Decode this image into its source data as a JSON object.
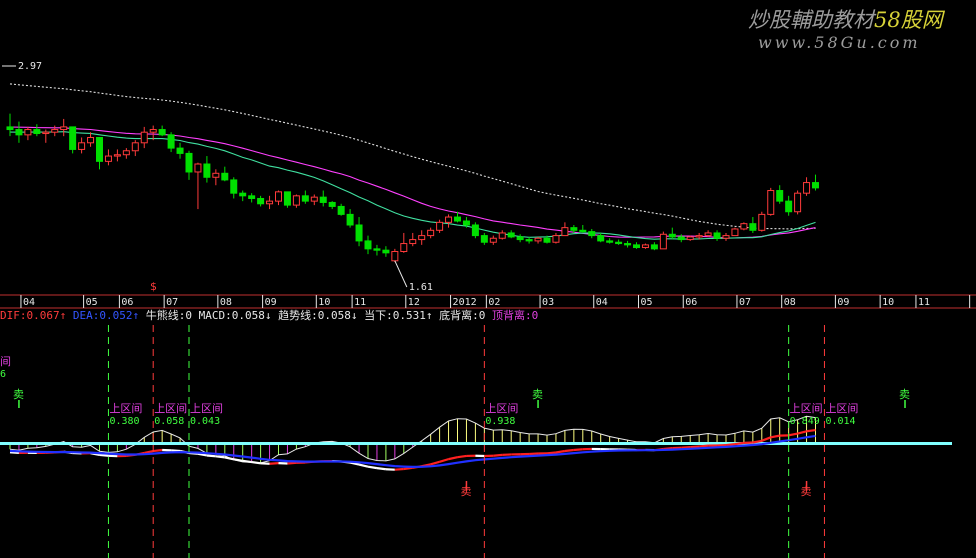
{
  "watermark": {
    "site_name": "炒股輔助教材",
    "site_brand": "58股网",
    "url": "www.58Gu.com"
  },
  "upper": {
    "high_label": "2.97",
    "low_label": "1.61",
    "ylim": [
      1.45,
      3.2
    ],
    "marker_label": "$"
  },
  "month_labels": [
    {
      "text": "04",
      "i": 1
    },
    {
      "text": "05",
      "i": 8
    },
    {
      "text": "06",
      "i": 12
    },
    {
      "text": "07",
      "i": 17
    },
    {
      "text": "08",
      "i": 23
    },
    {
      "text": "09",
      "i": 28
    },
    {
      "text": "10",
      "i": 34
    },
    {
      "text": "11",
      "i": 38
    },
    {
      "text": "12",
      "i": 44
    },
    {
      "text": "2012",
      "i": 49
    },
    {
      "text": "02",
      "i": 53
    },
    {
      "text": "03",
      "i": 59
    },
    {
      "text": "04",
      "i": 65
    },
    {
      "text": "05",
      "i": 70
    },
    {
      "text": "06",
      "i": 75
    },
    {
      "text": "07",
      "i": 81
    },
    {
      "text": "08",
      "i": 86
    },
    {
      "text": "09",
      "i": 92
    },
    {
      "text": "10",
      "i": 97
    },
    {
      "text": "11",
      "i": 101
    },
    {
      "text": "",
      "i": 107
    }
  ],
  "status_line": [
    {
      "text": "DIF:0.067",
      "color": "#ff3b3b"
    },
    {
      "text": "↑",
      "color": "#ff3b3b"
    },
    {
      "text": "DEA:0.052",
      "color": "#3355ff"
    },
    {
      "text": "↑",
      "color": "#3355ff"
    },
    {
      "text": "牛熊线:0",
      "color": "#e8e8e8"
    },
    {
      "text": "MACD:0.058",
      "color": "#e8e8e8"
    },
    {
      "text": "↓",
      "color": "#e8e8e8"
    },
    {
      "text": "趋势线:0.058",
      "color": "#e8e8e8"
    },
    {
      "text": "↓",
      "color": "#e8e8e8"
    },
    {
      "text": "当下:0.531",
      "color": "#e8e8e8"
    },
    {
      "text": "↑",
      "color": "#e8e8e8"
    },
    {
      "text": "底背离:0",
      "color": "#e8e8e8"
    },
    {
      "text": "顶背离:0",
      "color": "#e040e0"
    }
  ],
  "signals": {
    "up_label": "上区间",
    "top_left_label": "间",
    "top_left_value": "6",
    "sell_label": "卖",
    "intervals": [
      {
        "i": 11,
        "value": "0.380"
      },
      {
        "i": 16,
        "value": "0.058"
      },
      {
        "i": 20,
        "value": "0.043"
      },
      {
        "i": 53,
        "value": "0.938"
      },
      {
        "i": 87,
        "value": "0.849"
      },
      {
        "i": 91,
        "value": "0.014"
      }
    ],
    "green_dash_i": [
      11,
      20,
      87
    ],
    "red_dash_i": [
      16,
      53,
      91
    ],
    "sell_marks": [
      {
        "i": 1,
        "side": "top"
      },
      {
        "i": 59,
        "side": "top"
      },
      {
        "i": 51,
        "side": "bottom"
      },
      {
        "i": 100,
        "side": "top"
      },
      {
        "i": 89,
        "side": "bottom"
      }
    ]
  },
  "colors": {
    "up": "#ff3b3b",
    "down": "#00e000",
    "ma_short": "#e0e0e0",
    "ma_mid": "#ff40ff",
    "ma_long": "#40e0a0",
    "dif": "#ffffff",
    "dif_up": "#ff2020",
    "dea": "#2030ff",
    "bar_pos": "#ffff80",
    "bar_neg": "#e040e0",
    "zero_band": "#80ffff",
    "signal_green": "#40ff40",
    "signal_magenta": "#e040e0"
  },
  "chart_data": {
    "type": "line",
    "title": "",
    "xlabel": "",
    "ylabel": "",
    "candles": [
      [
        2.62,
        2.72,
        2.55,
        2.6
      ],
      [
        2.6,
        2.66,
        2.5,
        2.56
      ],
      [
        2.56,
        2.62,
        2.52,
        2.6
      ],
      [
        2.6,
        2.64,
        2.55,
        2.57
      ],
      [
        2.57,
        2.6,
        2.5,
        2.58
      ],
      [
        2.58,
        2.63,
        2.55,
        2.6
      ],
      [
        2.6,
        2.68,
        2.55,
        2.62
      ],
      [
        2.62,
        2.62,
        2.42,
        2.45
      ],
      [
        2.45,
        2.54,
        2.42,
        2.5
      ],
      [
        2.5,
        2.58,
        2.47,
        2.54
      ],
      [
        2.54,
        2.54,
        2.3,
        2.36
      ],
      [
        2.36,
        2.45,
        2.33,
        2.4
      ],
      [
        2.4,
        2.45,
        2.36,
        2.41
      ],
      [
        2.41,
        2.46,
        2.38,
        2.44
      ],
      [
        2.44,
        2.52,
        2.4,
        2.5
      ],
      [
        2.5,
        2.62,
        2.46,
        2.58
      ],
      [
        2.58,
        2.63,
        2.52,
        2.6
      ],
      [
        2.6,
        2.63,
        2.55,
        2.56
      ],
      [
        2.56,
        2.58,
        2.43,
        2.46
      ],
      [
        2.46,
        2.5,
        2.38,
        2.42
      ],
      [
        2.42,
        2.44,
        2.22,
        2.28
      ],
      [
        2.28,
        2.35,
        2.0,
        2.34
      ],
      [
        2.34,
        2.4,
        2.2,
        2.24
      ],
      [
        2.24,
        2.3,
        2.18,
        2.27
      ],
      [
        2.27,
        2.32,
        2.21,
        2.22
      ],
      [
        2.22,
        2.24,
        2.08,
        2.12
      ],
      [
        2.12,
        2.14,
        2.06,
        2.1
      ],
      [
        2.1,
        2.12,
        2.05,
        2.08
      ],
      [
        2.08,
        2.1,
        2.02,
        2.04
      ],
      [
        2.04,
        2.1,
        2.0,
        2.06
      ],
      [
        2.06,
        2.14,
        2.03,
        2.13
      ],
      [
        2.13,
        2.13,
        2.01,
        2.03
      ],
      [
        2.03,
        2.11,
        2.01,
        2.1
      ],
      [
        2.1,
        2.14,
        2.04,
        2.06
      ],
      [
        2.06,
        2.11,
        2.03,
        2.09
      ],
      [
        2.09,
        2.14,
        2.02,
        2.05
      ],
      [
        2.05,
        2.06,
        2.0,
        2.02
      ],
      [
        2.02,
        2.04,
        1.95,
        1.96
      ],
      [
        1.96,
        2.0,
        1.86,
        1.88
      ],
      [
        1.88,
        1.94,
        1.72,
        1.76
      ],
      [
        1.76,
        1.8,
        1.66,
        1.7
      ],
      [
        1.7,
        1.73,
        1.65,
        1.69
      ],
      [
        1.69,
        1.72,
        1.64,
        1.67
      ],
      [
        1.61,
        1.7,
        1.6,
        1.68
      ],
      [
        1.68,
        1.82,
        1.67,
        1.74
      ],
      [
        1.74,
        1.82,
        1.72,
        1.77
      ],
      [
        1.77,
        1.84,
        1.73,
        1.8
      ],
      [
        1.8,
        1.86,
        1.78,
        1.84
      ],
      [
        1.84,
        1.92,
        1.82,
        1.9
      ],
      [
        1.9,
        1.96,
        1.86,
        1.94
      ],
      [
        1.94,
        1.98,
        1.9,
        1.91
      ],
      [
        1.91,
        1.94,
        1.86,
        1.88
      ],
      [
        1.88,
        1.9,
        1.78,
        1.8
      ],
      [
        1.8,
        1.82,
        1.73,
        1.75
      ],
      [
        1.75,
        1.8,
        1.73,
        1.78
      ],
      [
        1.78,
        1.84,
        1.77,
        1.82
      ],
      [
        1.82,
        1.84,
        1.78,
        1.79
      ],
      [
        1.79,
        1.81,
        1.75,
        1.77
      ],
      [
        1.77,
        1.79,
        1.74,
        1.76
      ],
      [
        1.76,
        1.79,
        1.74,
        1.78
      ],
      [
        1.78,
        1.8,
        1.74,
        1.75
      ],
      [
        1.75,
        1.82,
        1.74,
        1.8
      ],
      [
        1.8,
        1.9,
        1.8,
        1.86
      ],
      [
        1.86,
        1.88,
        1.82,
        1.84
      ],
      [
        1.84,
        1.88,
        1.82,
        1.83
      ],
      [
        1.83,
        1.85,
        1.78,
        1.8
      ],
      [
        1.8,
        1.82,
        1.75,
        1.76
      ],
      [
        1.76,
        1.78,
        1.74,
        1.75
      ],
      [
        1.75,
        1.77,
        1.73,
        1.74
      ],
      [
        1.74,
        1.76,
        1.71,
        1.73
      ],
      [
        1.73,
        1.75,
        1.7,
        1.71
      ],
      [
        1.71,
        1.74,
        1.7,
        1.73
      ],
      [
        1.73,
        1.75,
        1.69,
        1.7
      ],
      [
        1.7,
        1.83,
        1.7,
        1.81
      ],
      [
        1.81,
        1.86,
        1.77,
        1.79
      ],
      [
        1.79,
        1.81,
        1.75,
        1.77
      ],
      [
        1.77,
        1.8,
        1.76,
        1.79
      ],
      [
        1.79,
        1.82,
        1.77,
        1.8
      ],
      [
        1.8,
        1.84,
        1.79,
        1.82
      ],
      [
        1.82,
        1.84,
        1.76,
        1.78
      ],
      [
        1.78,
        1.82,
        1.76,
        1.8
      ],
      [
        1.8,
        1.86,
        1.8,
        1.85
      ],
      [
        1.85,
        1.9,
        1.84,
        1.89
      ],
      [
        1.89,
        1.94,
        1.82,
        1.84
      ],
      [
        1.84,
        1.98,
        1.83,
        1.96
      ],
      [
        1.96,
        2.16,
        1.95,
        2.14
      ],
      [
        2.14,
        2.18,
        2.04,
        2.06
      ],
      [
        2.06,
        2.1,
        1.95,
        1.98
      ],
      [
        1.98,
        2.14,
        1.96,
        2.12
      ],
      [
        2.12,
        2.24,
        2.1,
        2.2
      ],
      [
        2.2,
        2.26,
        2.14,
        2.16
      ]
    ]
  }
}
